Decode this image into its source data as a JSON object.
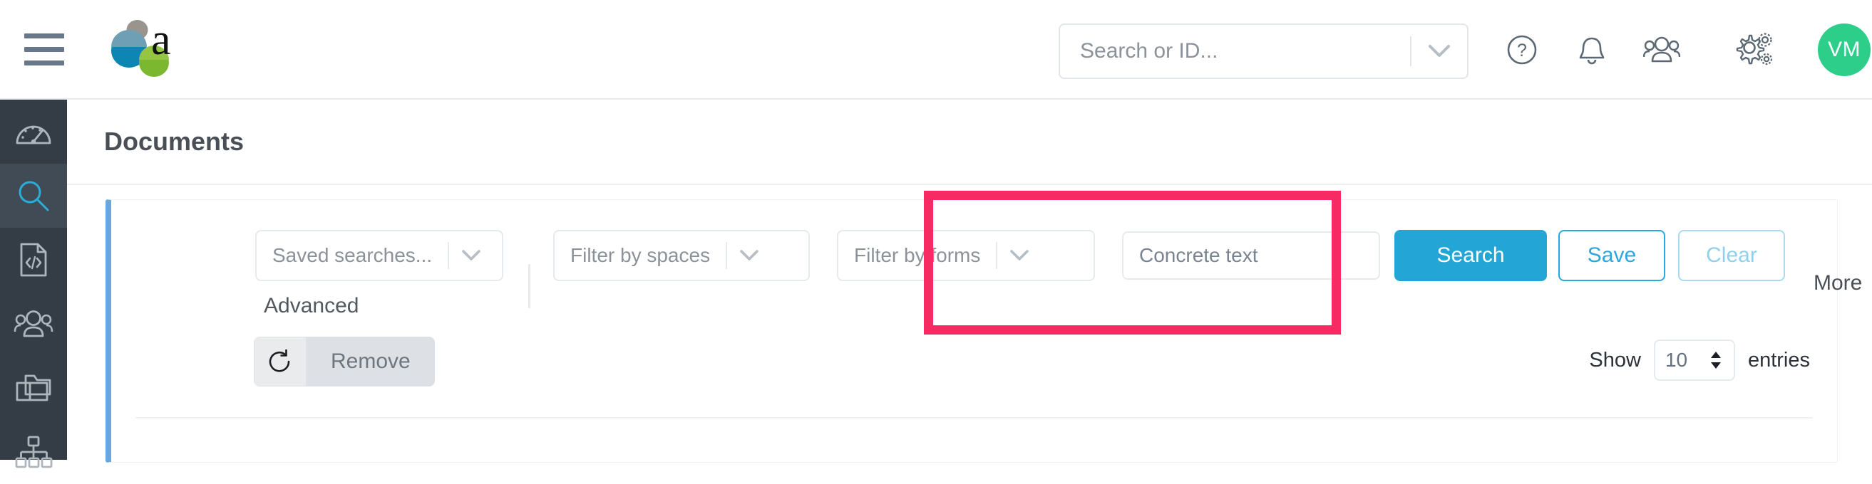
{
  "header": {
    "menu_icon": "hamburger-icon",
    "logo_alt": "a-logo",
    "search": {
      "placeholder": "Search or ID...",
      "chevron_icon": "chevron-down-icon"
    },
    "icons": [
      {
        "name": "help-icon",
        "label": "?"
      },
      {
        "name": "notifications-bell-icon",
        "label": ""
      },
      {
        "name": "people-icon",
        "label": ""
      },
      {
        "name": "settings-gears-icon",
        "label": ""
      }
    ],
    "avatar": {
      "initials": "VM",
      "color": "#2dce89"
    },
    "apps_grid_icon": "apps-grid-icon"
  },
  "sidebar": {
    "items": [
      {
        "name": "sidebar-item-dashboard",
        "icon": "gauge-icon",
        "active": false
      },
      {
        "name": "sidebar-item-search",
        "icon": "search-icon",
        "active": true
      },
      {
        "name": "sidebar-item-documents",
        "icon": "document-code-icon",
        "active": false
      },
      {
        "name": "sidebar-item-people",
        "icon": "people-icon",
        "active": false
      },
      {
        "name": "sidebar-item-folders",
        "icon": "folders-icon",
        "active": false
      },
      {
        "name": "sidebar-item-hierarchy",
        "icon": "sitemap-icon",
        "active": false
      }
    ],
    "active_color": "#2badd8"
  },
  "page": {
    "title": "Documents"
  },
  "search_panel": {
    "saved_searches_placeholder": "Saved searches...",
    "filter_spaces_placeholder": "Filter by spaces",
    "filter_forms_placeholder": "Filter by forms",
    "concrete_text_placeholder": "Concrete text",
    "search_button": "Search",
    "save_button": "Save",
    "clear_button": "Clear",
    "more_label": "More",
    "advanced_label": "Advanced",
    "remove_button": "Remove",
    "refresh_icon": "refresh-icon",
    "accent_color": "#23a6d5",
    "card_accent_color": "#6aa7e0"
  },
  "table_controls": {
    "show_label": "Show",
    "entries_value": "10",
    "entries_label": "entries"
  },
  "annotation": {
    "highlight_color": "#f72a63",
    "highlight_target": "concrete-text-search-area"
  }
}
